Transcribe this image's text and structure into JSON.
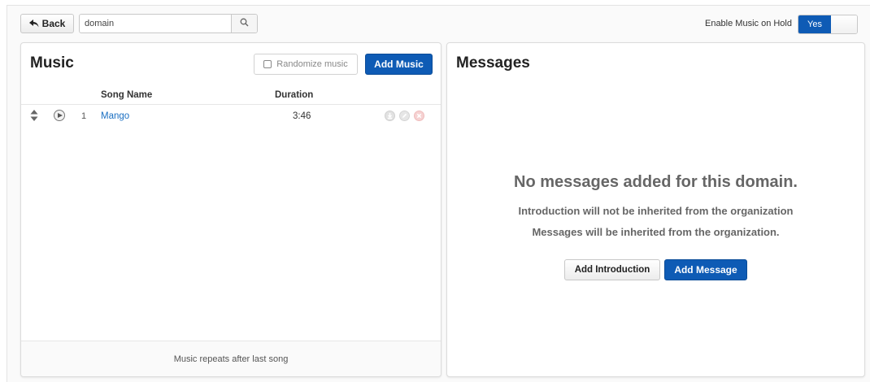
{
  "toolbar": {
    "back_label": "Back",
    "search_value": "domain",
    "search_icon": "search-icon",
    "moh_label": "Enable Music on Hold",
    "moh_toggle_value": "Yes",
    "accent_color": "#0e5bb5"
  },
  "music": {
    "title": "Music",
    "randomize_label": "Randomize music",
    "randomize_checked": false,
    "add_music_label": "Add Music",
    "columns": {
      "song_name": "Song Name",
      "duration": "Duration"
    },
    "songs": [
      {
        "index": "1",
        "name": "Mango",
        "duration": "3:46",
        "icons": [
          "download-icon",
          "edit-icon",
          "delete-icon"
        ]
      }
    ],
    "footer_note": "Music repeats after last song"
  },
  "messages": {
    "title": "Messages",
    "empty_title": "No messages added for this domain.",
    "empty_line1": "Introduction will not be inherited from the organization",
    "empty_line2": "Messages will be inherited from the organization.",
    "add_intro_label": "Add Introduction",
    "add_message_label": "Add Message"
  }
}
